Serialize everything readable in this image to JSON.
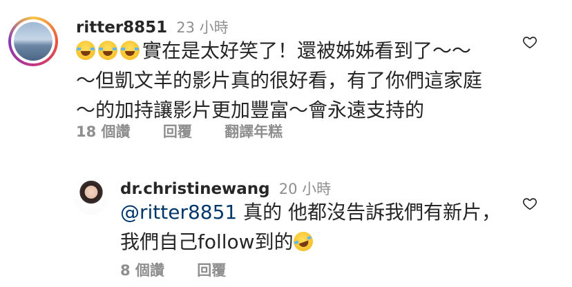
{
  "comment": {
    "username": "ritter8851",
    "time": "23 小時",
    "lines": [
      "實在是太好笑了！還被姊姊看到了～～",
      "～但凱文羊的影片真的很好看，有了你們這家庭",
      "～的加持讓影片更加豐富～會永遠支持的"
    ],
    "emoji_icons": [
      "joy-emoji",
      "joy-emoji",
      "joy-emoji"
    ],
    "likes": "18 個讚",
    "reply_label": "回覆",
    "translate_label": "翻譯年糕"
  },
  "reply": {
    "username": "dr.christinewang",
    "time": "20 小時",
    "mention": "@ritter8851",
    "line1_rest": " 真的 他都沒告訴我們有新片，",
    "line2": "我們自己follow到的",
    "emoji_icon": "rofl-emoji",
    "likes": "8 個讚",
    "reply_label": "回覆"
  },
  "icons": {
    "like": "heart-outline-icon"
  },
  "colors": {
    "text": "#262626",
    "secondary": "#8e8e8e",
    "mention": "#00376b"
  }
}
